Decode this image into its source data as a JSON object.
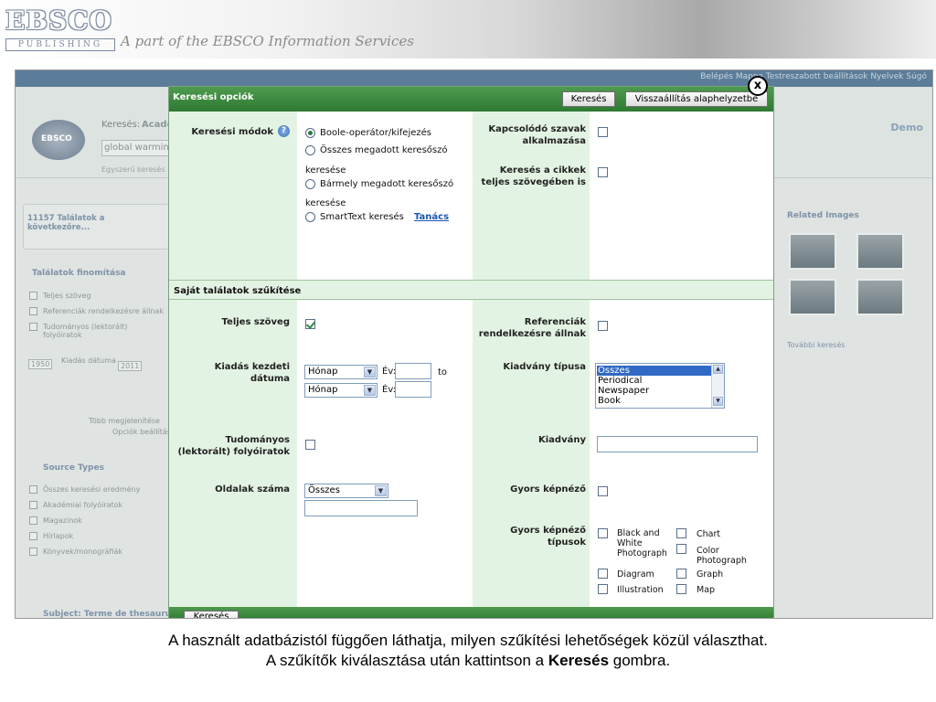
{
  "banner": {
    "logo_main": "EBSCO",
    "logo_sub": "PUBLISHING",
    "tagline": "A part of the EBSCO Information Services"
  },
  "background": {
    "topbar_links": "Belépés  Mappa  Testreszabott beállítások  Nyelvek  Súgó",
    "search_label": "Keresés:",
    "search_db": "Acade",
    "search_value": "global warming",
    "simple_search": "Egyszerű keresés",
    "logo_text": "EBSCO",
    "demo": "Demo",
    "results": "11157 Találatok a következőre...",
    "refine_title": "Találatok finomítása",
    "refine_items": [
      "Teljes szöveg",
      "Referenciák rendelkezésre állnak",
      "Tudományos (lektorált) folyóiratok"
    ],
    "date_from": "1950",
    "date_label": "Kiadás dátuma",
    "date_to": "2011",
    "more_options": "Több megjelenítése",
    "options_settings": "Opciók beállítása",
    "source_types_title": "Source Types",
    "source_items": [
      "Összes keresési eredmény",
      "Akadémiai folyóiratok",
      "Magazinok",
      "Hírlapok",
      "Könyvek/monográfiák"
    ],
    "thesaurus": "Subject: Terme de thesaurus",
    "related_images": "Related Images",
    "more_images": "További keresés"
  },
  "dialog": {
    "title": "Keresési opciók",
    "search_button": "Keresés",
    "reset_button": "Visszaállítás alaphelyzetbe",
    "close_symbol": "x",
    "search_modes_label": "Keresési módok",
    "search_modes": [
      {
        "label": "Boole-operátor/kifejezés",
        "selected": true
      },
      {
        "label": "Összes megadott keresőszó",
        "cont": "keresése",
        "selected": false
      },
      {
        "label": "Bármely megadott keresőszó",
        "cont": "keresése",
        "selected": false
      },
      {
        "label": "SmartText keresés",
        "selected": false
      }
    ],
    "hint_link": "Tanács",
    "related_words_label": "Kapcsolódó szavak alkalmazása",
    "fulltext_search_label": "Keresés a cikkek teljes szövegében is",
    "section2_title": "Saját találatok szűkítése",
    "fulltext_label": "Teljes szöveg",
    "fulltext_checked": true,
    "references_label": "Referenciák rendelkezésre állnak",
    "pub_date_label": "Kiadás kezdeti dátuma",
    "month_placeholder": "Hónap",
    "year_label": "Év:",
    "to_label": "to",
    "pub_type_label": "Kiadvány típusa",
    "pub_types": [
      "Összes",
      "Periodical",
      "Newspaper",
      "Book"
    ],
    "pub_type_selected": "Összes",
    "peer_reviewed_label": "Tudományos (lektorált) folyóiratok",
    "publication_label": "Kiadvány",
    "pages_label": "Oldalak száma",
    "pages_value": "Összes",
    "quick_view_label": "Gyors képnéző",
    "quick_view_types_label": "Gyors képnéző típusok",
    "image_types": [
      [
        "Black and White Photograph",
        "Chart"
      ],
      [
        "Color Photograph",
        ""
      ],
      [
        "Diagram",
        "Graph"
      ],
      [
        "Illustration",
        "Map"
      ]
    ],
    "bottom_button": "Keresés"
  },
  "caption": {
    "line1": "A használt adatbázistól függően láthatja, milyen szűkítési lehetőségek közül választhat.",
    "line2_pre": "A szűkítők kiválasztása után kattintson a ",
    "line2_bold": "Keresés",
    "line2_post": " gombra."
  },
  "colors": {
    "dialog_header": "#3a8a3e",
    "dialog_panel": "#e3f3e3",
    "topbar": "#5b7d99"
  }
}
